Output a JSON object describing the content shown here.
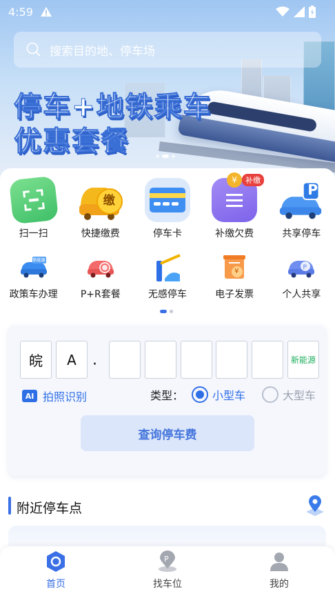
{
  "status_bar": {
    "time": "4:59"
  },
  "search": {
    "placeholder": "搜索目的地、停车场"
  },
  "banner": {
    "line1": "停车+地铁乘车",
    "line2": "优惠套餐"
  },
  "services_row1": [
    {
      "label": "扫一扫",
      "icon": "scan-icon"
    },
    {
      "label": "快捷缴费",
      "icon": "quick-pay-icon",
      "badge_char": "缴"
    },
    {
      "label": "停车卡",
      "icon": "parking-card-icon"
    },
    {
      "label": "补缴欠费",
      "icon": "arrears-icon",
      "badge": "补缴",
      "coin": "¥"
    },
    {
      "label": "共享停车",
      "icon": "shared-parking-icon",
      "badge_char": "P"
    }
  ],
  "services_row2": [
    {
      "label": "政策车办理",
      "icon": "policy-car-icon",
      "tag": "新能源"
    },
    {
      "label": "P+R套餐",
      "icon": "p-r-package-icon"
    },
    {
      "label": "无感停车",
      "icon": "seamless-parking-icon"
    },
    {
      "label": "电子发票",
      "icon": "e-invoice-icon",
      "coin": "¥"
    },
    {
      "label": "个人共享",
      "icon": "personal-share-icon"
    }
  ],
  "plate": {
    "province": "皖",
    "letter": "A",
    "separator": "·",
    "new_energy_label": "新能源"
  },
  "photo_recognition": {
    "ai": "AI",
    "label": "拍照识别"
  },
  "vehicle_type": {
    "label": "类型：",
    "options": [
      {
        "label": "小型车",
        "selected": true
      },
      {
        "label": "大型车",
        "selected": false
      }
    ]
  },
  "query_button": "查询停车费",
  "nearby": {
    "title": "附近停车点"
  },
  "bottom_nav": [
    {
      "label": "首页",
      "icon": "home-icon",
      "active": true
    },
    {
      "label": "找车位",
      "icon": "find-parking-icon",
      "active": false
    },
    {
      "label": "我的",
      "icon": "profile-icon",
      "active": false
    }
  ],
  "colors": {
    "primary": "#3a6fe6",
    "new_energy": "#1fae5d",
    "badge_red": "#e8403c"
  }
}
